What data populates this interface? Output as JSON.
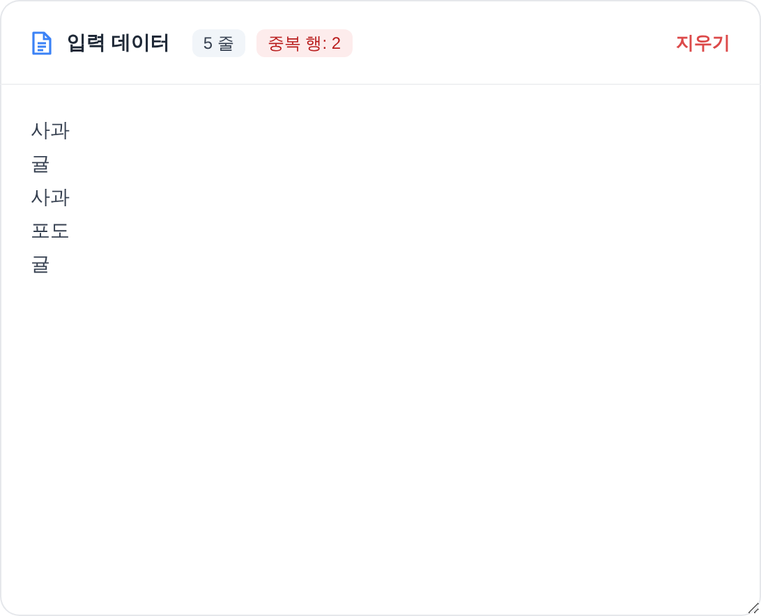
{
  "header": {
    "title": "입력 데이터",
    "line_count": "5 줄",
    "duplicates": "중복 행: 2",
    "clear_button": "지우기"
  },
  "input": {
    "lines": [
      "사과",
      "귤",
      "사과",
      "포도",
      "귤"
    ]
  }
}
